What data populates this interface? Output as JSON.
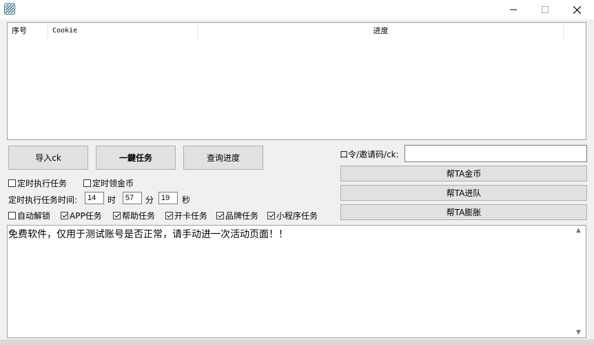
{
  "window": {
    "icon": "app-icon",
    "controls": {
      "minimize": "─",
      "maximize": "☐",
      "close": "✕"
    }
  },
  "table": {
    "columns": [
      "序号",
      "Cookie",
      "进度",
      ""
    ],
    "rows": []
  },
  "buttons": {
    "import": "导入ck",
    "one_key": "一鍵任务",
    "query": "查询进度",
    "help_coin": "帮TA金币",
    "help_team": "帮TA进队",
    "help_expand": "帮TA膨胀"
  },
  "code": {
    "label": "口令/邀请码/ck:",
    "value": ""
  },
  "schedule": {
    "timed_task": {
      "label": "定时执行任务",
      "checked": false
    },
    "timed_coin": {
      "label": "定时领金币",
      "checked": false
    },
    "time_label": "定时执行任务时间:",
    "hour": "14",
    "hour_unit": "时",
    "minute": "57",
    "minute_unit": "分",
    "second": "19",
    "second_unit": "秒"
  },
  "options": [
    {
      "label": "自动解锁",
      "checked": false
    },
    {
      "label": "APP任务",
      "checked": true
    },
    {
      "label": "帮助任务",
      "checked": true
    },
    {
      "label": "开卡任务",
      "checked": true
    },
    {
      "label": "品牌任务",
      "checked": true
    },
    {
      "label": "小程序任务",
      "checked": true
    }
  ],
  "log": {
    "text": "免费软件，仅用于测试账号是否正常，请手动进一次活动页面！！"
  }
}
